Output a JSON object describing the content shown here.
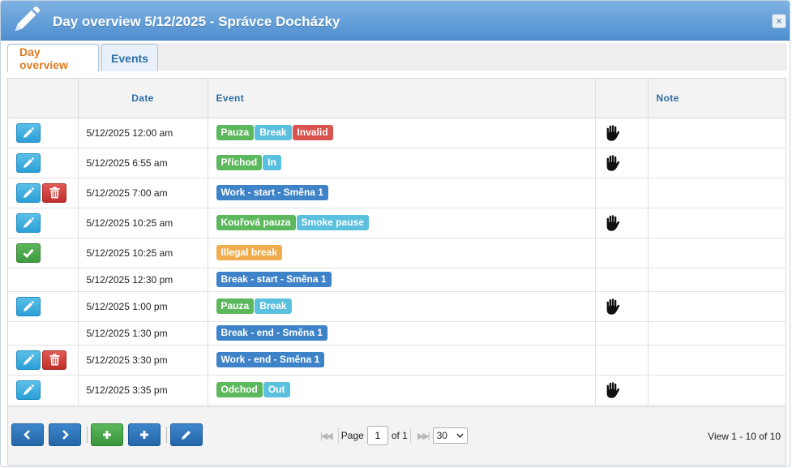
{
  "window": {
    "title": "Day overview 5/12/2025 - Správce Docházky",
    "close_label": "×"
  },
  "tabs": [
    {
      "label": "Day overview",
      "active": true
    },
    {
      "label": "Events",
      "active": false
    }
  ],
  "grid": {
    "columns": {
      "date": "Date",
      "event": "Event",
      "note": "Note"
    },
    "rows": [
      {
        "actions": [
          "edit"
        ],
        "date": "5/12/2025 12:00 am",
        "tags": [
          {
            "text": "Pauza",
            "color": "green"
          },
          {
            "text": "Break",
            "color": "teal"
          },
          {
            "text": "Invalid",
            "color": "red"
          }
        ],
        "hand": true,
        "note": ""
      },
      {
        "actions": [
          "edit"
        ],
        "date": "5/12/2025 6:55 am",
        "tags": [
          {
            "text": "Příchod",
            "color": "green"
          },
          {
            "text": "In",
            "color": "teal"
          }
        ],
        "hand": true,
        "note": ""
      },
      {
        "actions": [
          "edit",
          "delete"
        ],
        "date": "5/12/2025 7:00 am",
        "tags": [
          {
            "text": "Work - start - Směna 1",
            "color": "blue"
          }
        ],
        "hand": false,
        "note": ""
      },
      {
        "actions": [
          "edit"
        ],
        "date": "5/12/2025 10:25 am",
        "tags": [
          {
            "text": "Kouřová pauza",
            "color": "green"
          },
          {
            "text": "Smoke pause",
            "color": "teal"
          }
        ],
        "hand": true,
        "note": ""
      },
      {
        "actions": [
          "approve"
        ],
        "date": "5/12/2025 10:25 am",
        "tags": [
          {
            "text": "Illegal break",
            "color": "orange"
          }
        ],
        "hand": false,
        "note": ""
      },
      {
        "actions": [],
        "date": "5/12/2025 12:30 pm",
        "tags": [
          {
            "text": "Break - start - Směna 1",
            "color": "blue"
          }
        ],
        "hand": false,
        "note": ""
      },
      {
        "actions": [
          "edit"
        ],
        "date": "5/12/2025 1:00 pm",
        "tags": [
          {
            "text": "Pauza",
            "color": "green"
          },
          {
            "text": "Break",
            "color": "teal"
          }
        ],
        "hand": true,
        "note": ""
      },
      {
        "actions": [],
        "date": "5/12/2025 1:30 pm",
        "tags": [
          {
            "text": "Break - end - Směna 1",
            "color": "blue"
          }
        ],
        "hand": false,
        "note": ""
      },
      {
        "actions": [
          "edit",
          "delete"
        ],
        "date": "5/12/2025 3:30 pm",
        "tags": [
          {
            "text": "Work - end - Směna 1",
            "color": "blue"
          }
        ],
        "hand": false,
        "note": ""
      },
      {
        "actions": [
          "edit"
        ],
        "date": "5/12/2025 3:35 pm",
        "tags": [
          {
            "text": "Odchod",
            "color": "green"
          },
          {
            "text": "Out",
            "color": "teal"
          }
        ],
        "hand": true,
        "note": ""
      }
    ]
  },
  "pager": {
    "page_label": "Page",
    "page_value": "1",
    "of_label": "of 1",
    "rows_per_page": "30",
    "view_info": "View 1 - 10 of 10"
  },
  "icons": {
    "title": "pencil-icon",
    "edit": "pencil-icon",
    "delete": "trash-icon",
    "approve": "check-icon",
    "manual": "hand-icon",
    "prev": "chevron-left-icon",
    "next": "chevron-right-icon",
    "add": "plus-icon"
  },
  "colors": {
    "green": "#5cb85c",
    "teal": "#5bc0de",
    "red": "#d9534f",
    "blue": "#3e83c8",
    "orange": "#f0ad4e",
    "active_tab": "#e07b22",
    "header_text": "#2e6da4"
  }
}
